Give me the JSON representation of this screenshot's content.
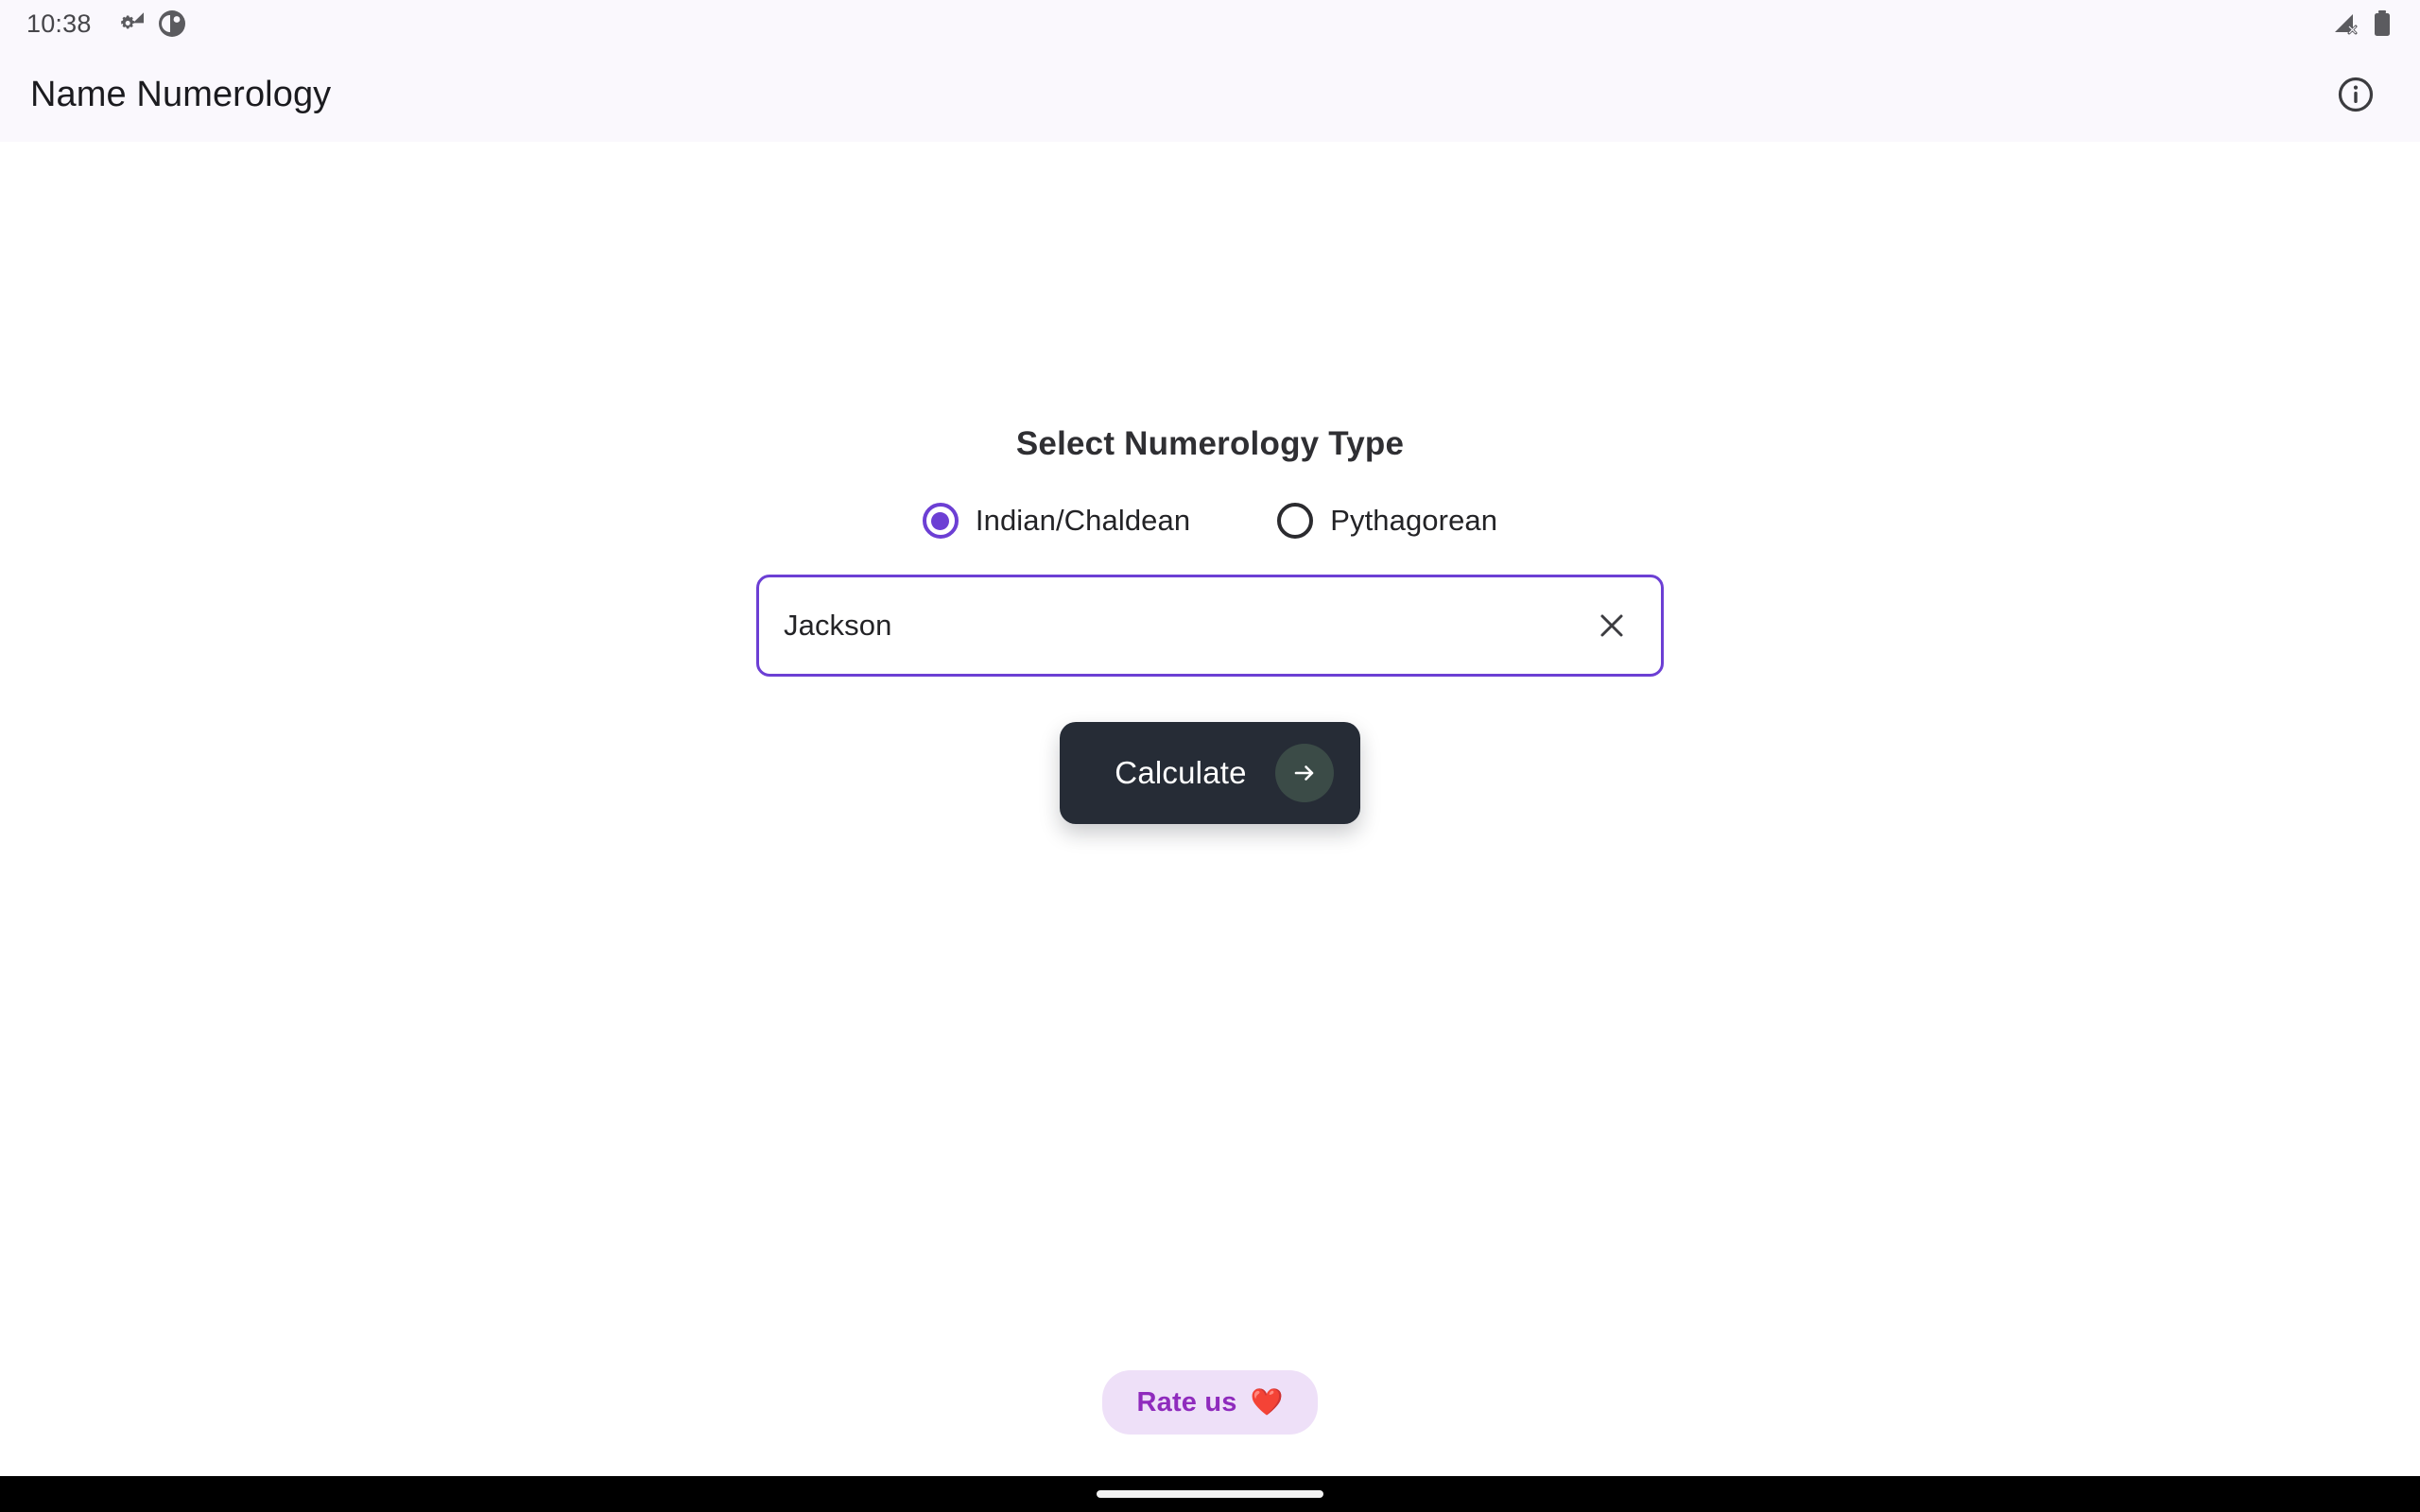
{
  "status_bar": {
    "clock": "10:38",
    "left_icons": [
      "settings-cast-icon",
      "app-badge-icon"
    ],
    "right_icons": [
      "signal-no-service-icon",
      "battery-full-icon"
    ]
  },
  "app_bar": {
    "title": "Name Numerology",
    "info_icon": "info-icon"
  },
  "main": {
    "heading": "Select Numerology Type",
    "numerology_types": [
      {
        "label": "Indian/Chaldean",
        "selected": true
      },
      {
        "label": "Pythagorean",
        "selected": false
      }
    ],
    "name_input": {
      "value": "Jackson",
      "placeholder": "Enter name",
      "clear_icon": "close-icon"
    },
    "calculate": {
      "label": "Calculate",
      "arrow_icon": "arrow-right-icon"
    },
    "rate": {
      "label": "Rate us",
      "emoji": "❤️"
    }
  },
  "colors": {
    "accent_purple": "#6C3FD4",
    "app_bar_bg": "#FAF8FD",
    "button_dark": "#262C36",
    "badge_green": "#3B4B47",
    "rate_bg": "#EEE0F8",
    "rate_text": "#8F2BBD"
  }
}
